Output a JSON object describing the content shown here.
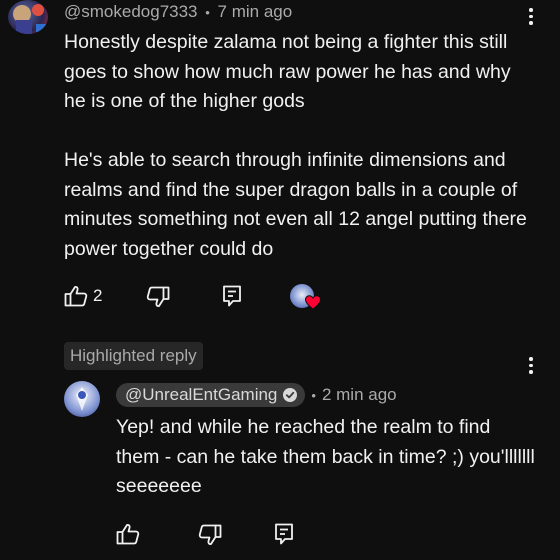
{
  "comment": {
    "handle": "@smokedog7333",
    "separator": "•",
    "time": "7 min ago",
    "paragraph1": "Honestly despite zalama not being a fighter this still goes to show how much raw power he has and why he is one of the higher gods",
    "paragraph2": "He's able to search through infinite dimensions and realms and find the super dragon balls in a couple of minutes something not even all 12 angel putting there power together could do",
    "like_count": "2",
    "icons": [
      "thumb-up-icon",
      "thumb-down-icon",
      "reply-icon",
      "creator-heart-icon"
    ]
  },
  "highlighted_label": "Highlighted reply",
  "reply": {
    "handle": "@UnrealEntGaming",
    "separator": "•",
    "time": "2 min ago",
    "text": "Yep! and while he reached the realm to find them - can he take them back in time? ;) you'lllllll seeeeeee",
    "icons": [
      "thumb-up-icon",
      "thumb-down-icon",
      "reply-icon"
    ]
  },
  "colors": {
    "background": "#0f0f0f",
    "text": "#f1f1f1",
    "meta": "#aaaaaa",
    "heart": "#ff0033",
    "chip": "#272727"
  }
}
